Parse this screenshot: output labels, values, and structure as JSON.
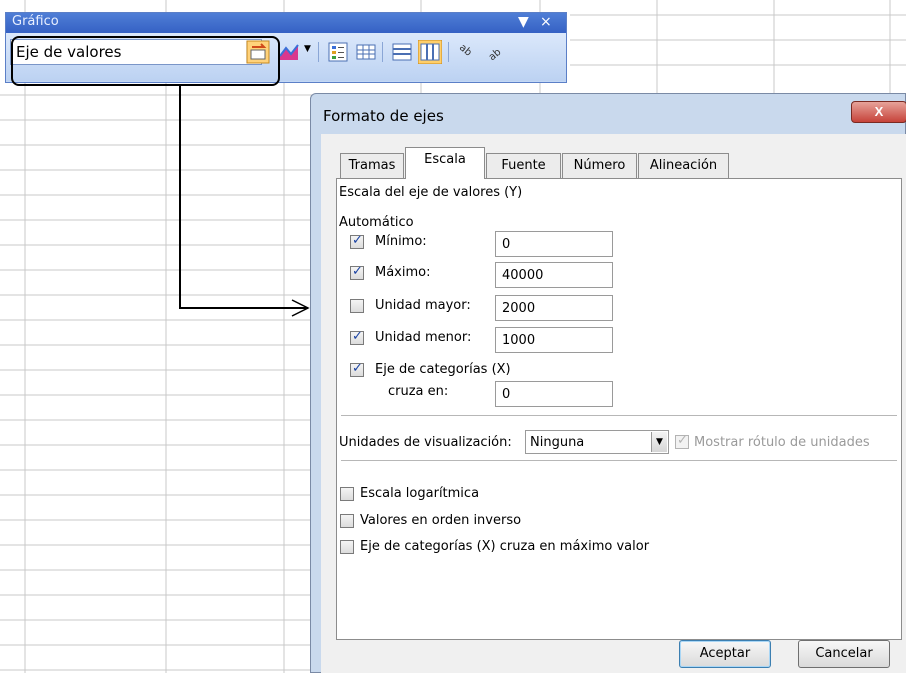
{
  "toolbar": {
    "title": "Gráfico",
    "chart_object": "Eje de valores",
    "title_buttons": [
      "▼",
      "×"
    ]
  },
  "dialog": {
    "title": "Formato de ejes",
    "close": "X",
    "tabs": [
      "Tramas",
      "Escala",
      "Fuente",
      "Número",
      "Alineación"
    ],
    "active_tab": "Escala",
    "section_title": "Escala del eje de valores (Y)",
    "auto_label": "Automático",
    "minimum": {
      "label": "Mínimo:",
      "checked": true,
      "value": "0"
    },
    "maximum": {
      "label": "Máximo:",
      "checked": true,
      "value": "40000"
    },
    "major_unit": {
      "label": "Unidad mayor:",
      "checked": false,
      "value": "2000"
    },
    "minor_unit": {
      "label": "Unidad menor:",
      "checked": true,
      "value": "1000"
    },
    "category_cross": {
      "label": "Eje de categorías (X)",
      "checked": true,
      "sub_label": "cruza en:",
      "value": "0"
    },
    "display_units": {
      "label": "Unidades de visualización:",
      "value": "Ninguna",
      "show_label": "Mostrar rótulo de unidades"
    },
    "log_scale": "Escala logarítmica",
    "reverse_order": "Valores en orden inverso",
    "cross_at_max": "Eje de categorías (X) cruza en máximo valor",
    "ok": "Aceptar",
    "cancel": "Cancelar"
  },
  "colors": {
    "toolbar_title": "#3561c4",
    "toolbar_body": "#c3d8f5",
    "dialog_frame": "#c9d9ed",
    "close_button": "#c6433a",
    "check_mark": "#1b43a3"
  }
}
